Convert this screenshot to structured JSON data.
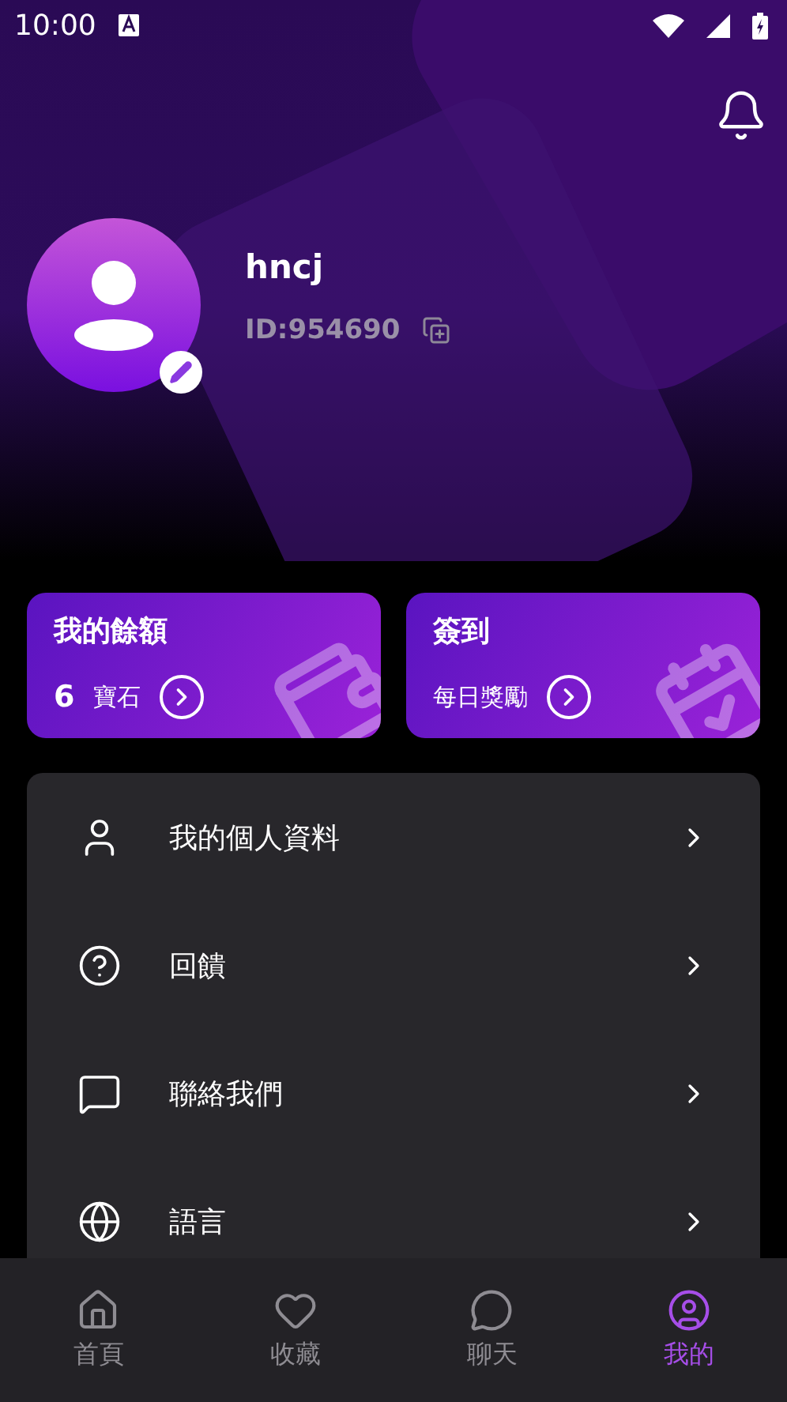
{
  "status_bar": {
    "time": "10:00"
  },
  "profile": {
    "name": "hncj",
    "id": "ID:954690"
  },
  "cards": [
    {
      "kind": "wallet",
      "title": "我的餘額",
      "value": "6",
      "unit": "寶石"
    },
    {
      "kind": "calendar",
      "title": "簽到",
      "unit": "每日獎勵"
    }
  ],
  "menu": [
    {
      "kind": "profile",
      "label": "我的個人資料"
    },
    {
      "kind": "feedback",
      "label": "回饋"
    },
    {
      "kind": "contact",
      "label": "聯絡我們"
    },
    {
      "kind": "language",
      "label": "語言"
    }
  ],
  "nav": [
    {
      "kind": "home",
      "label": "首頁",
      "selected": false
    },
    {
      "kind": "heart",
      "label": "收藏",
      "selected": false
    },
    {
      "kind": "chat",
      "label": "聊天",
      "selected": false
    },
    {
      "kind": "me",
      "label": "我的",
      "selected": true
    }
  ]
}
